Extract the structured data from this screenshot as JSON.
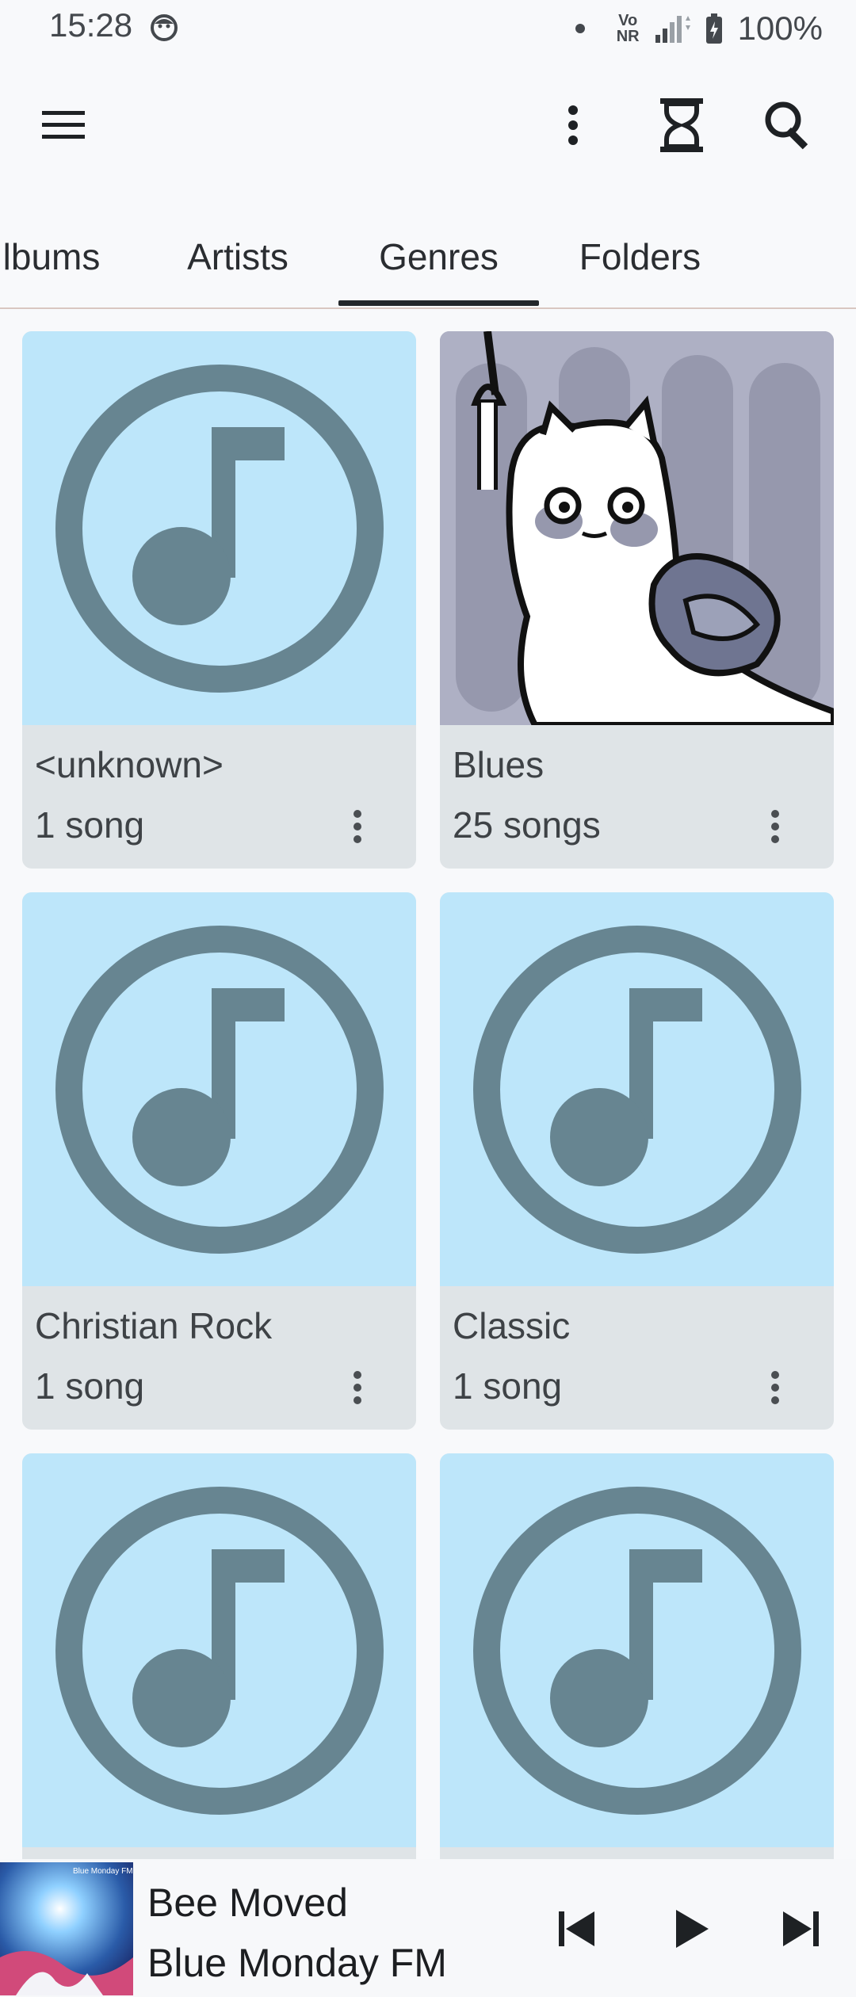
{
  "status_bar": {
    "time": "15:28",
    "network_label_top": "Vo",
    "network_label_bottom": "NR",
    "battery": "100%"
  },
  "tabs": [
    {
      "label": "lbums",
      "active": false
    },
    {
      "label": "Artists",
      "active": false
    },
    {
      "label": "Genres",
      "active": true
    },
    {
      "label": "Folders",
      "active": false
    }
  ],
  "genres": [
    {
      "name": "<unknown>",
      "count": "1 song",
      "art": "music-note"
    },
    {
      "name": "Blues",
      "count": "25 songs",
      "art": "cat-illustration"
    },
    {
      "name": "Christian Rock",
      "count": "1 song",
      "art": "music-note"
    },
    {
      "name": "Classic",
      "count": "1 song",
      "art": "music-note"
    },
    {
      "name": "",
      "count": "",
      "art": "music-note"
    },
    {
      "name": "",
      "count": "",
      "art": "music-note"
    }
  ],
  "player": {
    "title": "Bee Moved",
    "artist": "Blue Monday FM",
    "cover_text": "Blue Monday FM"
  },
  "colors": {
    "art_background": "#bde6fa",
    "note_icon": "#678591",
    "card_footer": "#dfe4e7",
    "tab_indicator": "#23272b"
  }
}
